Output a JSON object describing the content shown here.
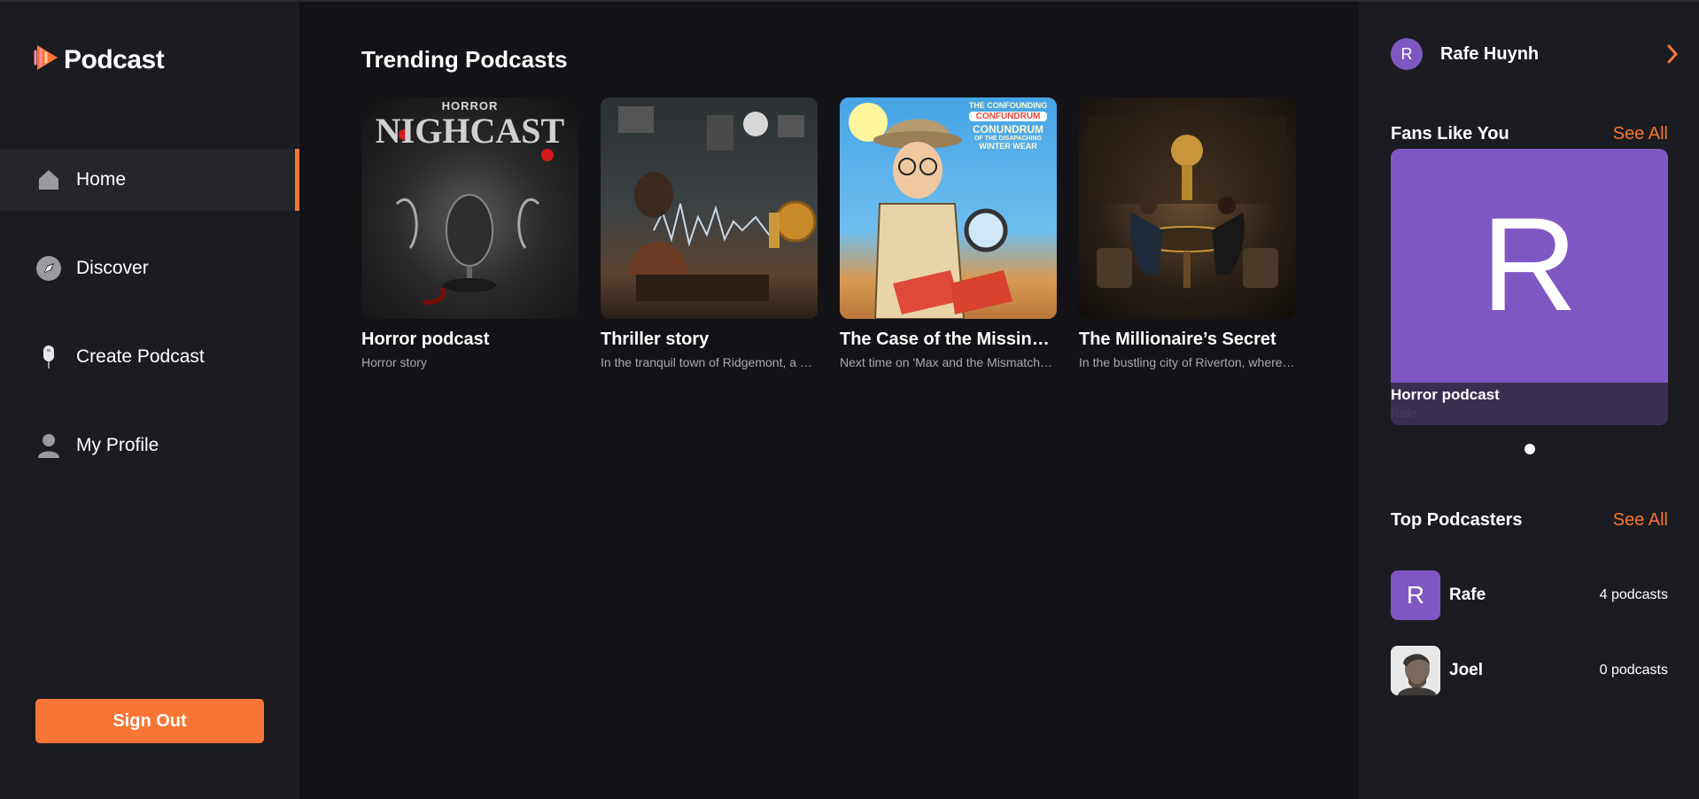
{
  "sidebar": {
    "logo_text": "Podcast",
    "nav": [
      {
        "label": "Home",
        "icon": "home-icon"
      },
      {
        "label": "Discover",
        "icon": "compass-icon"
      },
      {
        "label": "Create Podcast",
        "icon": "microphone-icon"
      },
      {
        "label": "My Profile",
        "icon": "user-icon"
      }
    ],
    "signout_label": "Sign Out"
  },
  "main": {
    "title": "Trending Podcasts",
    "cards": [
      {
        "title": "Horror podcast",
        "desc": "Horror story",
        "art_text_1": "HORROR",
        "art_text_2": "NIGHCAST"
      },
      {
        "title": "Thriller story",
        "desc": "In the tranquil town of Ridgemont, a series of mysterious events"
      },
      {
        "title": "The Case of the Missing Mittens",
        "desc": "Next time on 'Max and the Mismatched Mittens', our hero",
        "art_lines": [
          "THE CONFOUNDING",
          "CONFUNDRUM",
          "CONUNDRUM",
          "OF THE DISAPACHING",
          "WINTER WEAR"
        ]
      },
      {
        "title": "The Millionaire’s Secret",
        "desc": "In the bustling city of Riverton, where the rich reside"
      }
    ]
  },
  "right": {
    "user": {
      "initial": "R",
      "name": "Rafe Huynh"
    },
    "fans": {
      "title": "Fans Like You",
      "see_all": "See All",
      "card": {
        "initial": "R",
        "title": "Horror podcast",
        "subtitle": "Rafe"
      }
    },
    "top": {
      "title": "Top Podcasters",
      "see_all": "See All",
      "items": [
        {
          "initial": "R",
          "name": "Rafe",
          "count": "4 podcasts"
        },
        {
          "initial": "",
          "name": "Joel",
          "count": "0 podcasts"
        }
      ]
    }
  },
  "colors": {
    "accent": "#f97535",
    "purple": "#7e58c2",
    "sidebar": "#1b1c21",
    "main": "#121217"
  }
}
